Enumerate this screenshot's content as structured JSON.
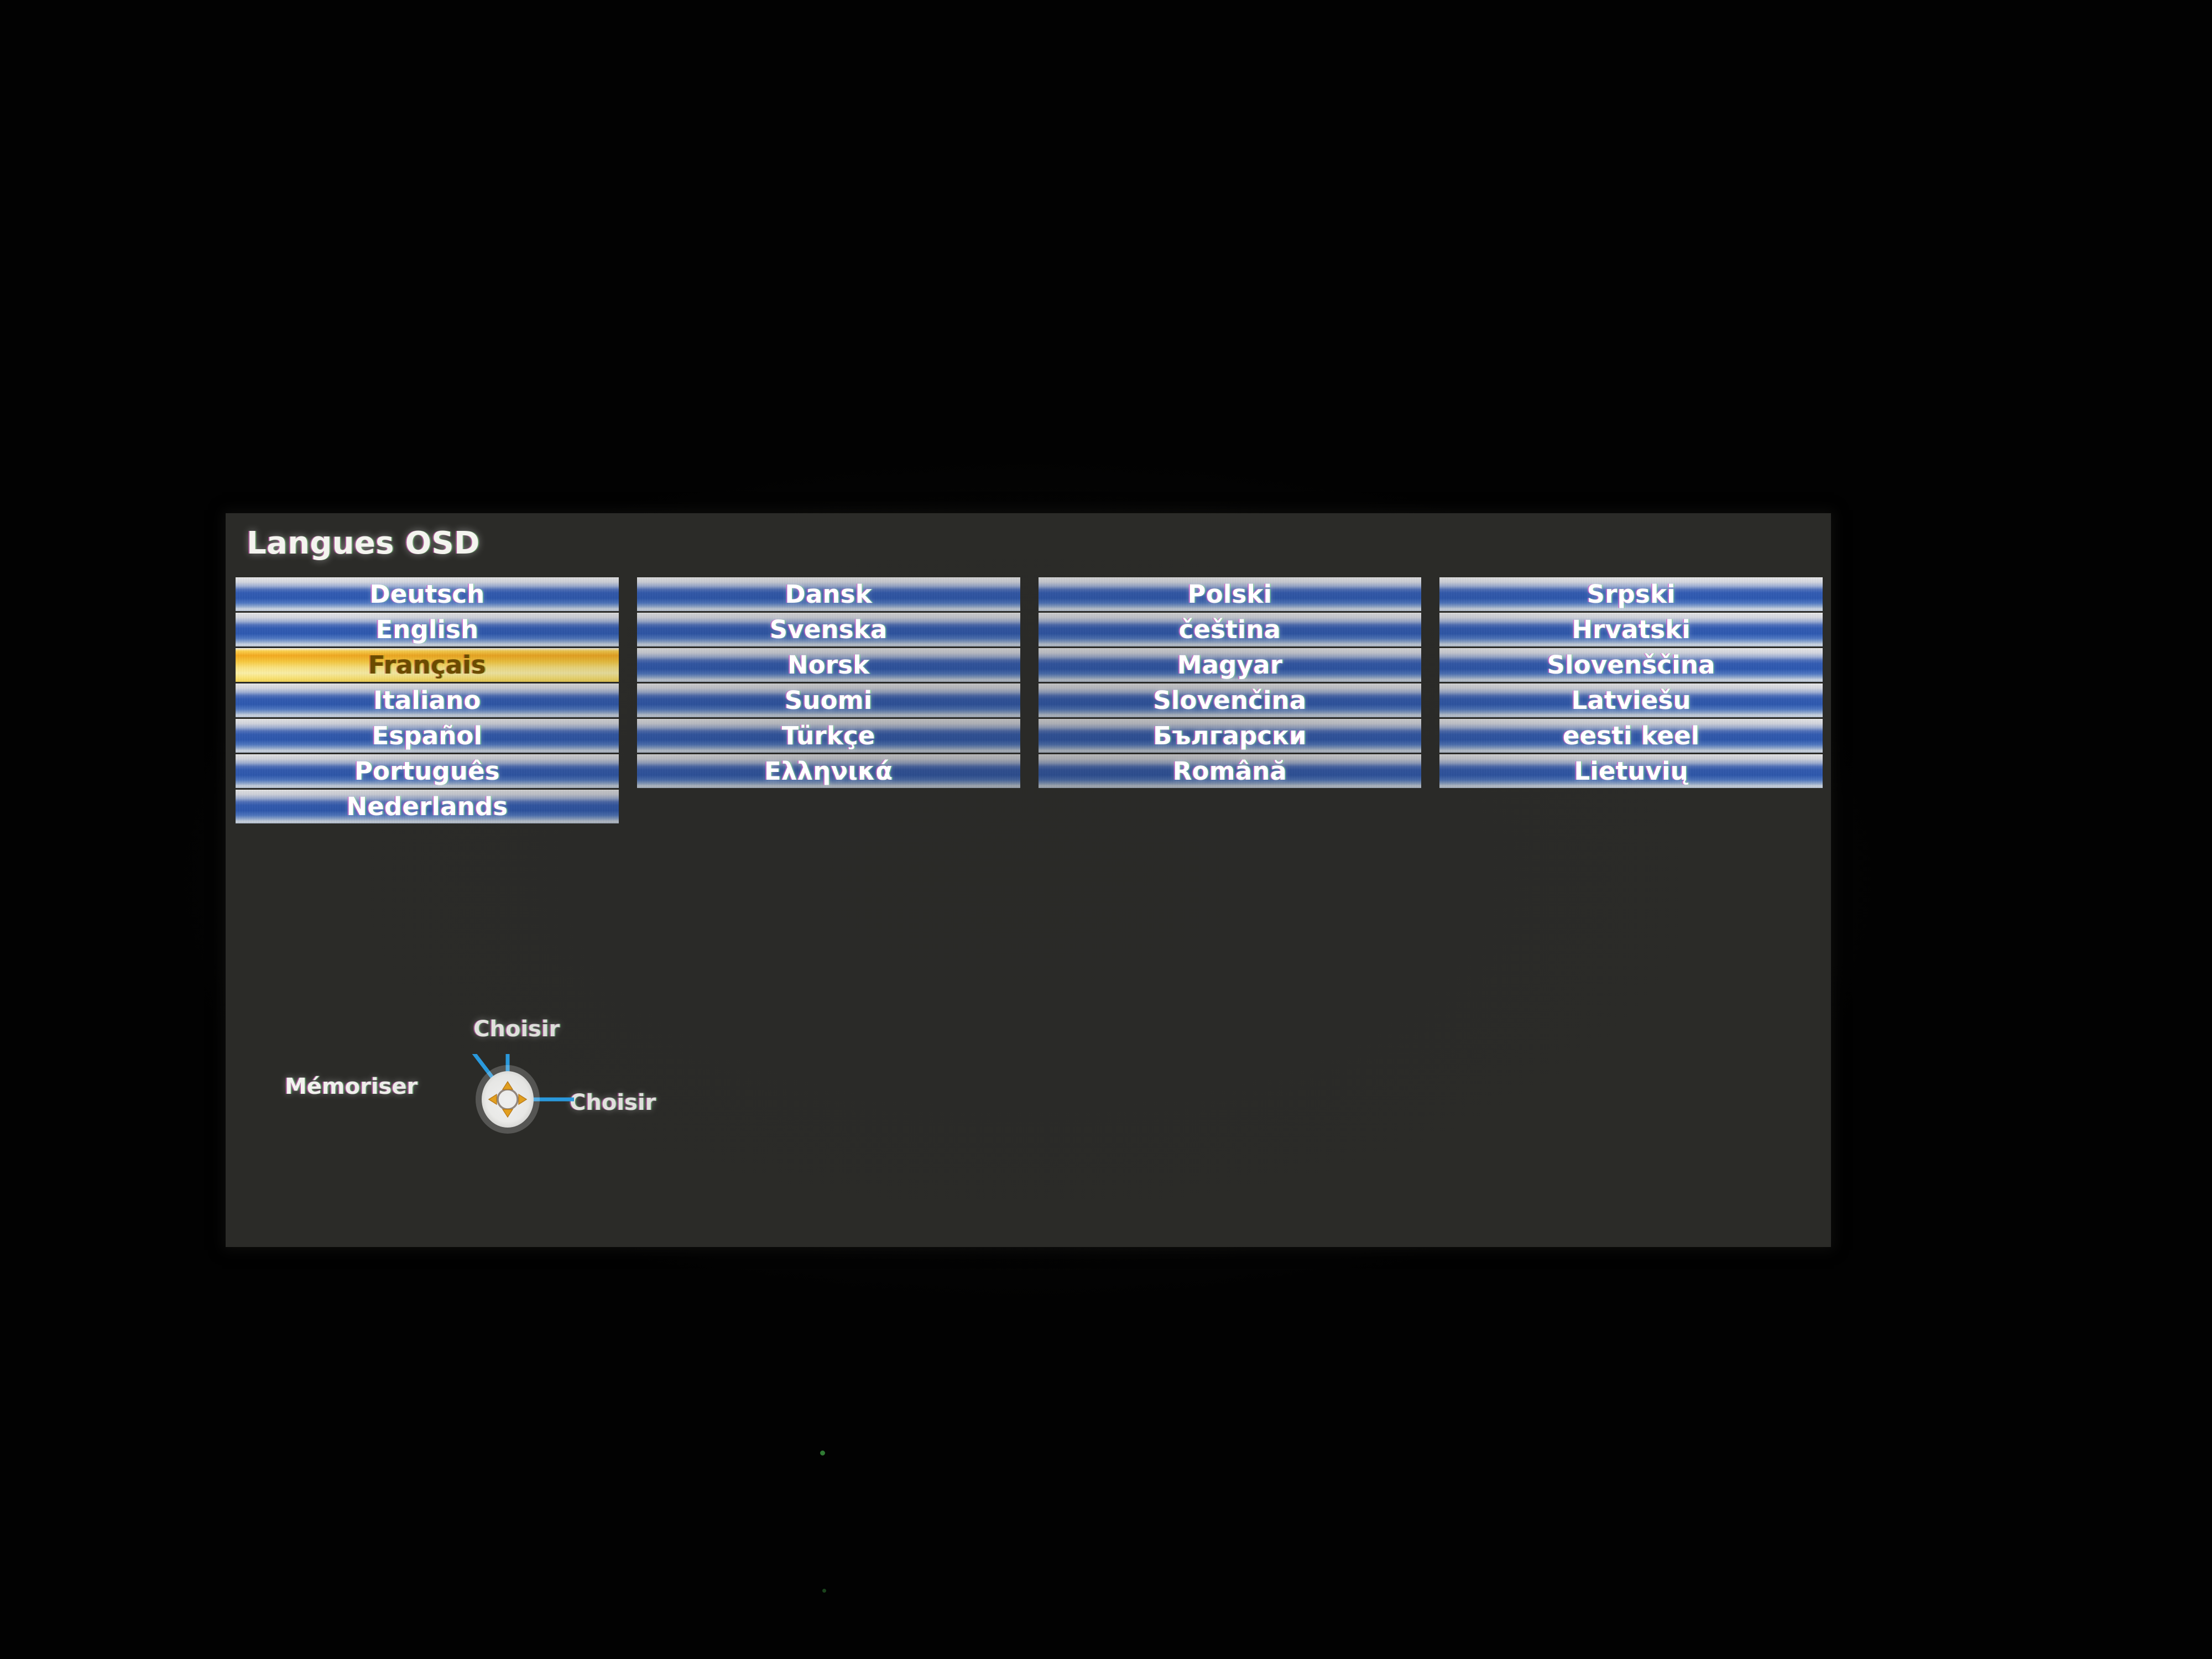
{
  "screen": {
    "background_color": "#000000"
  },
  "osd": {
    "title": "Langues OSD",
    "panel_color": "#2b2b28",
    "accent_selected_color": "#f7ab1c",
    "item_color": "#2a57b2",
    "text_color": "#ffffff",
    "selected_text_color": "#6b4b00",
    "columns": [
      {
        "name": "column-1",
        "items": [
          {
            "label": "Deutsch",
            "selected": false
          },
          {
            "label": "English",
            "selected": false
          },
          {
            "label": "Français",
            "selected": true
          },
          {
            "label": "Italiano",
            "selected": false
          },
          {
            "label": "Español",
            "selected": false
          },
          {
            "label": "Português",
            "selected": false
          },
          {
            "label": "Nederlands",
            "selected": false
          }
        ]
      },
      {
        "name": "column-2",
        "items": [
          {
            "label": "Dansk",
            "selected": false
          },
          {
            "label": "Svenska",
            "selected": false
          },
          {
            "label": "Norsk",
            "selected": false
          },
          {
            "label": "Suomi",
            "selected": false
          },
          {
            "label": "Türkçe",
            "selected": false
          },
          {
            "label": "Ελληνικά",
            "selected": false
          }
        ]
      },
      {
        "name": "column-3",
        "items": [
          {
            "label": "Polski",
            "selected": false
          },
          {
            "label": "čeština",
            "selected": false
          },
          {
            "label": "Magyar",
            "selected": false
          },
          {
            "label": "Slovenčina",
            "selected": false
          },
          {
            "label": "Български",
            "selected": false
          },
          {
            "label": "Română",
            "selected": false
          }
        ]
      },
      {
        "name": "column-4",
        "items": [
          {
            "label": "Srpski",
            "selected": false
          },
          {
            "label": "Hrvatski",
            "selected": false
          },
          {
            "label": "Slovenščina",
            "selected": false
          },
          {
            "label": "Latviešu",
            "selected": false
          },
          {
            "label": "eesti keel",
            "selected": false
          },
          {
            "label": "Lietuvių",
            "selected": false
          }
        ]
      }
    ]
  },
  "legend": {
    "up_label": "Choisir",
    "left_label": "Mémoriser",
    "right_label": "Choisir",
    "dpad_icon": "dpad-navigation-icon",
    "dpad_body_color": "#f5f5f5",
    "dpad_arrow_color": "#f0a81e",
    "connector_color": "#2aa4ee"
  }
}
